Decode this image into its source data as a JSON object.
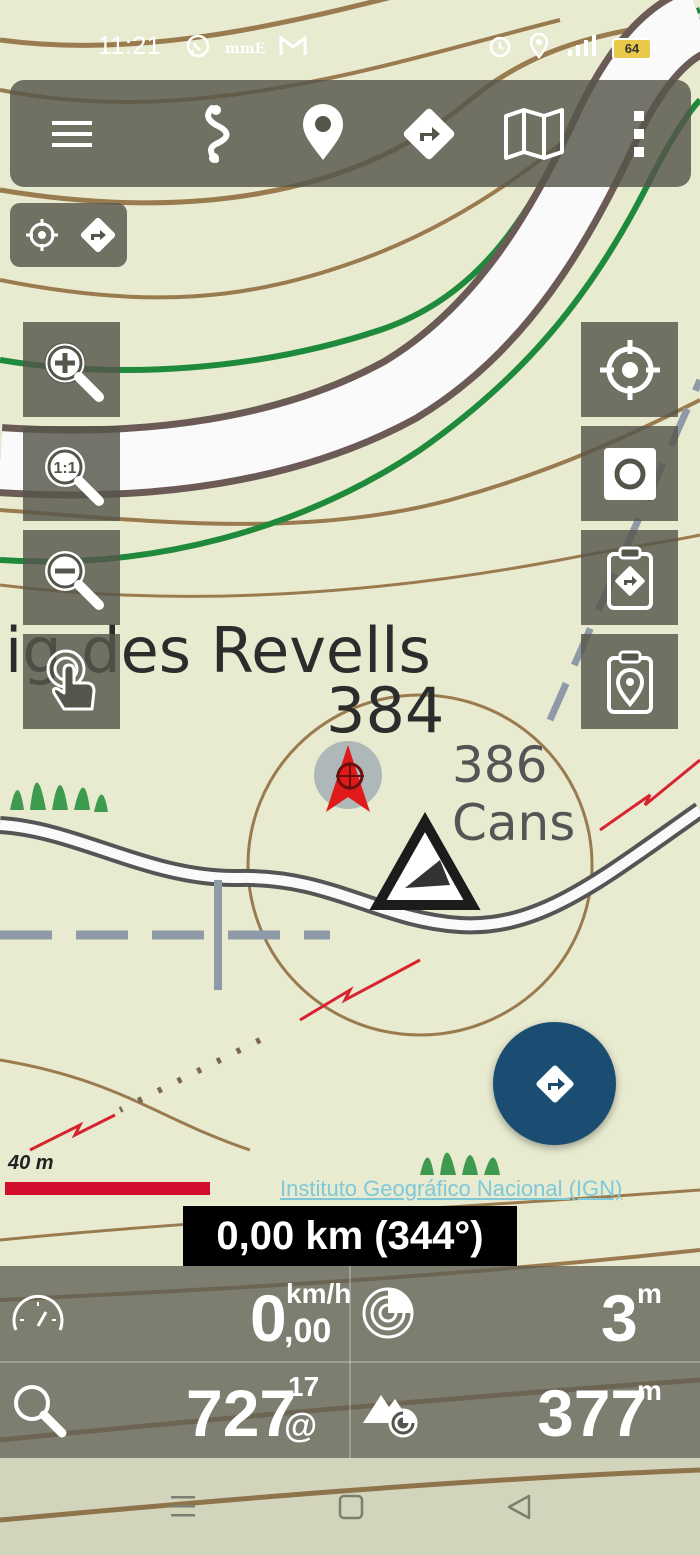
{
  "status_bar": {
    "time": "11:21",
    "left_icons": [
      "whatsapp-icon",
      "app-notification-icon",
      "gmail-icon"
    ],
    "carrier_badge": "mE",
    "battery": "64",
    "right_icons": [
      "alarm-icon",
      "location-icon",
      "signal-icon",
      "battery-icon"
    ]
  },
  "toolbar": {
    "buttons": [
      "menu-icon",
      "route-icon",
      "waypoint-icon",
      "navigate-icon",
      "map-layers-icon",
      "more-icon"
    ]
  },
  "map": {
    "labels": {
      "place_name": "ig des Revells",
      "elevation_1": "384",
      "elevation_2": "386",
      "place_2": "Cans"
    }
  },
  "scale": {
    "label": "40 m"
  },
  "attribution": "Instituto Geográfico Nacional (IGN)",
  "distance_readout": "0,00 km (344°)",
  "dashboard": {
    "speed": {
      "value": "0",
      "decimal": ",00",
      "unit": "km/h",
      "icon": "speedometer-icon"
    },
    "accuracy": {
      "value": "3",
      "unit": "m",
      "icon": "gps-accuracy-icon"
    },
    "search": {
      "value": "727",
      "superscript": "17",
      "subscript": "@",
      "icon": "search-icon"
    },
    "altitude": {
      "value": "377",
      "unit": "m",
      "icon": "altitude-icon"
    }
  },
  "colors": {
    "panel": "#55554b",
    "fab": "#1b4d72",
    "scale_bar": "#d10e2b",
    "attribution": "#7ec8d9",
    "map_bg": "#e9ecd2"
  }
}
